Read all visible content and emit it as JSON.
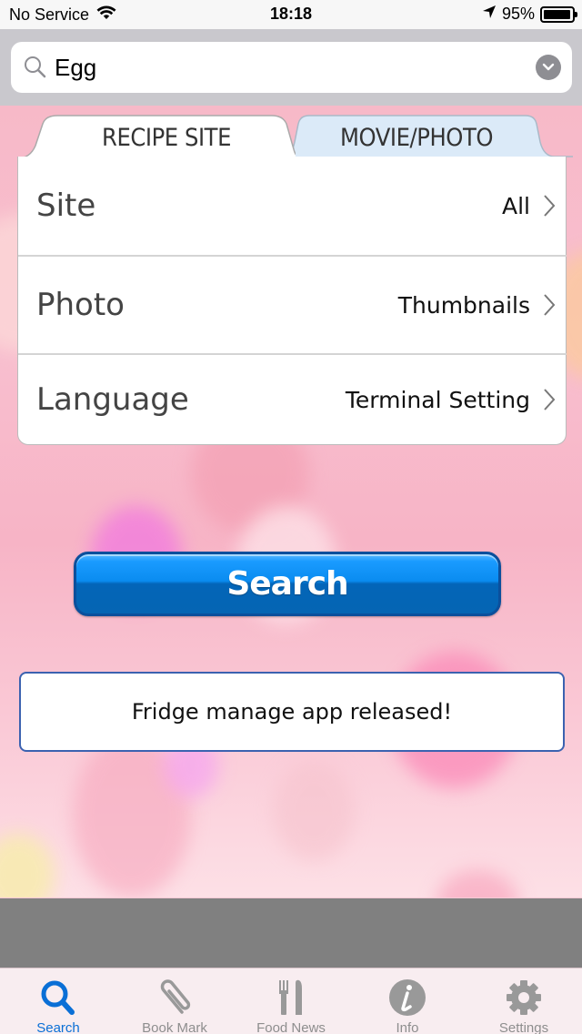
{
  "status_bar": {
    "carrier": "No Service",
    "time": "18:18",
    "battery_percent": "95%",
    "battery_level": 0.95
  },
  "search": {
    "value": "Egg",
    "placeholder": ""
  },
  "tabs": [
    {
      "label": "RECIPE SITE",
      "active": true
    },
    {
      "label": "MOVIE/PHOTO",
      "active": false
    }
  ],
  "settings": [
    {
      "label": "Site",
      "value": "All"
    },
    {
      "label": "Photo",
      "value": "Thumbnails"
    },
    {
      "label": "Language",
      "value": "Terminal Setting"
    }
  ],
  "search_button_label": "Search",
  "news_banner": "Fridge manage app released!",
  "tab_bar": [
    {
      "label": "Search",
      "icon": "search-icon",
      "active": true
    },
    {
      "label": "Book Mark",
      "icon": "paperclip-icon",
      "active": false
    },
    {
      "label": "Food News",
      "icon": "fork-knife-icon",
      "active": false
    },
    {
      "label": "Info",
      "icon": "info-icon",
      "active": false
    },
    {
      "label": "Settings",
      "icon": "gear-icon",
      "active": false
    }
  ],
  "colors": {
    "accent": "#0a6fd6",
    "inactive_tab": "#8e8e8e",
    "movie_tab_bg": "#dbeaf8",
    "search_button": "#0a8cf0",
    "banner_border": "#3b62b0"
  }
}
